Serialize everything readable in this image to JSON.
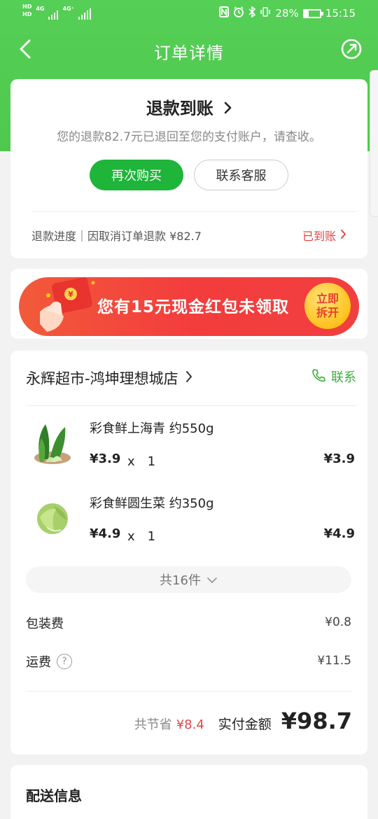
{
  "status_bar": {
    "hd1": "HD",
    "hd2": "HD",
    "network1": "4G",
    "network2": "4G⁺",
    "battery_percent": "28%",
    "battery_level": 0.28,
    "time": "15:15",
    "icons": [
      "nfc-icon",
      "alarm-icon",
      "bluetooth-icon",
      "vibrate-icon",
      "battery-icon"
    ]
  },
  "navbar": {
    "title": "订单详情",
    "back_icon": "chevron-left-icon",
    "share_icon": "share-icon"
  },
  "refund": {
    "title": "退款到账",
    "description": "您的退款82.7元已退回至您的支付账户，请查收。",
    "buy_again_label": "再次购买",
    "contact_service_label": "联系客服",
    "progress_text": "退款进度｜因取消订单退款 ¥82.7",
    "progress_status": "已到账"
  },
  "promo": {
    "text": "您有15元现金红包未领取",
    "button_line1": "立即",
    "button_line2": "拆开"
  },
  "store": {
    "name": "永辉超市-鸿坤理想城店",
    "contact_label": "联系",
    "items": [
      {
        "name": "彩食鲜上海青 约550g",
        "price": "¥3.9",
        "qty": "x　1",
        "total": "¥3.9",
        "image_icon": "bok-choy-image"
      },
      {
        "name": "彩食鲜圆生菜 约350g",
        "price": "¥4.9",
        "qty": "x　1",
        "total": "¥4.9",
        "image_icon": "lettuce-image"
      }
    ],
    "more_label": "共16件",
    "packaging_label": "包装费",
    "packaging_fee": "¥0.8",
    "shipping_label": "运费",
    "shipping_fee": "¥11.5",
    "saved_label": "共节省",
    "saved_value": "¥8.4",
    "paid_label": "实付金额",
    "paid_value": "¥98.7"
  },
  "delivery": {
    "title": "配送信息"
  },
  "colors": {
    "brand_green": "#4ec94e",
    "button_green": "#1fb43a",
    "alert_red": "#e54545"
  }
}
